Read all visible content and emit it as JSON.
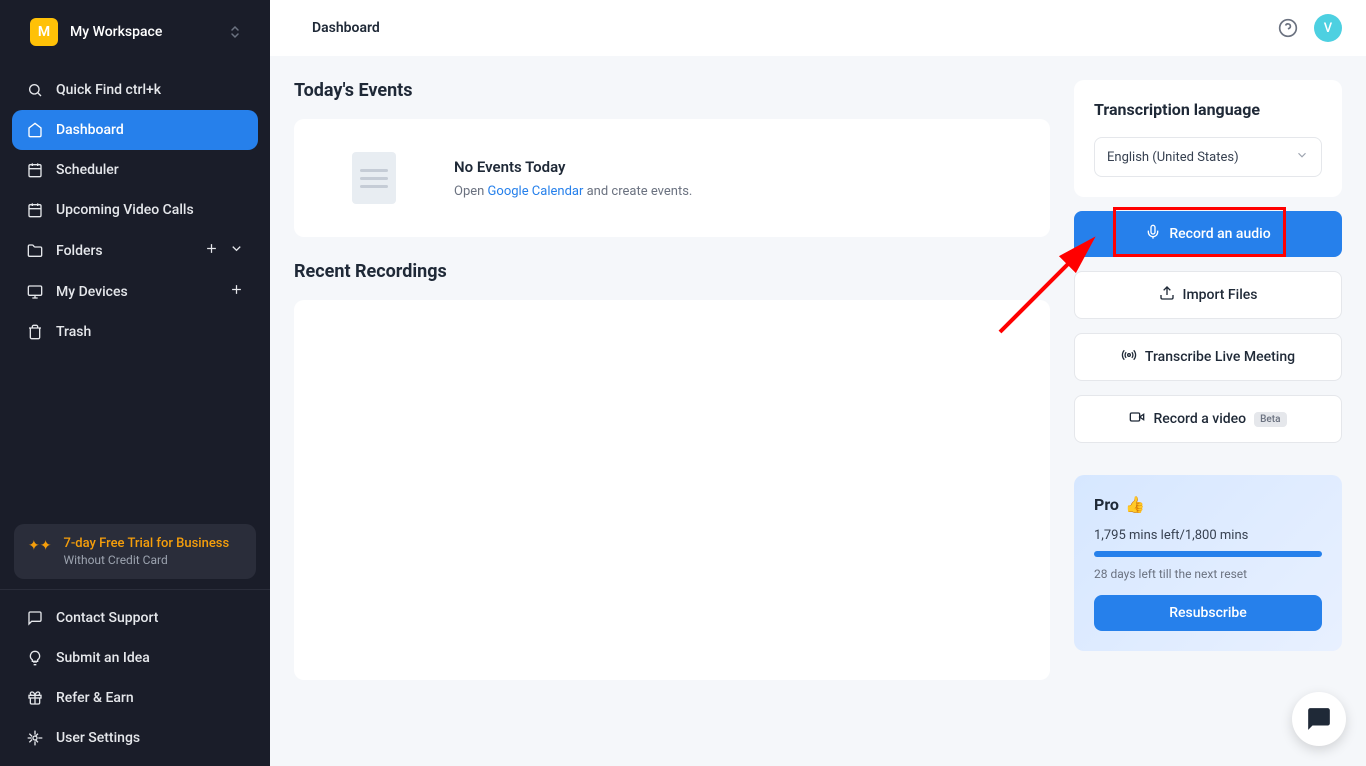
{
  "workspace": {
    "initial": "M",
    "name": "My Workspace"
  },
  "sidebar": {
    "quick_find": "Quick Find ctrl+k",
    "items": {
      "dashboard": "Dashboard",
      "scheduler": "Scheduler",
      "upcoming": "Upcoming Video Calls",
      "folders": "Folders",
      "devices": "My Devices",
      "trash": "Trash"
    },
    "trial": {
      "title": "7-day Free Trial for Business",
      "subtitle": "Without Credit Card"
    },
    "footer": {
      "contact": "Contact Support",
      "submit": "Submit an Idea",
      "refer": "Refer & Earn",
      "settings": "User Settings"
    }
  },
  "topbar": {
    "title": "Dashboard",
    "avatar_initial": "V"
  },
  "events": {
    "section_title": "Today's Events",
    "heading": "No Events Today",
    "open_text": "Open ",
    "link_text": "Google Calendar",
    "after_text": " and create events."
  },
  "recordings": {
    "section_title": "Recent Recordings"
  },
  "lang": {
    "title": "Transcription language",
    "selected": "English (United States)"
  },
  "actions": {
    "record_audio": "Record an audio",
    "import_files": "Import Files",
    "transcribe_live": "Transcribe Live Meeting",
    "record_video": "Record a video",
    "beta": "Beta"
  },
  "pro": {
    "title": "Pro",
    "mins": "1,795 mins left/1,800 mins",
    "days": "28 days left till the next reset",
    "resubscribe": "Resubscribe"
  }
}
